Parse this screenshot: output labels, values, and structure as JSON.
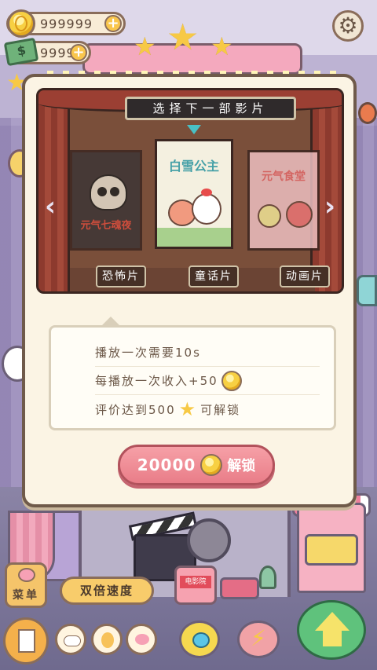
{
  "resources": {
    "coins": "999999",
    "cash": "9999"
  },
  "modal": {
    "title": "选择下一部影片",
    "movies": [
      {
        "genre": "恐怖片",
        "poster_title": "元气七魂夜"
      },
      {
        "genre": "童话片",
        "poster_title": "白雪公主"
      },
      {
        "genre": "动画片",
        "poster_title": "元气食堂"
      }
    ],
    "info": {
      "duration": "播放一次需要10s",
      "income": "每播放一次收入+50",
      "rating_prefix": "评价达到500",
      "rating_suffix": "可解锁"
    },
    "unlock": {
      "cost": "20000",
      "label": "解锁"
    }
  },
  "hud": {
    "menu_label": "菜单",
    "speed_label": "双倍速度",
    "ticket_label": "电影院"
  },
  "icons": {
    "coin": "coin-icon",
    "cash": "cash-icon",
    "settings": "gear-icon",
    "prev": "chevron-left-icon",
    "next": "chevron-right-icon",
    "star": "star-icon",
    "upgrade": "arrow-up-icon",
    "bolt": "lightning-icon"
  },
  "colors": {
    "modal_bg": "#fbf4e4",
    "unlock_button": "#e97d88",
    "selection_arrow": "#49c0c4",
    "coin": "#f7d043"
  }
}
